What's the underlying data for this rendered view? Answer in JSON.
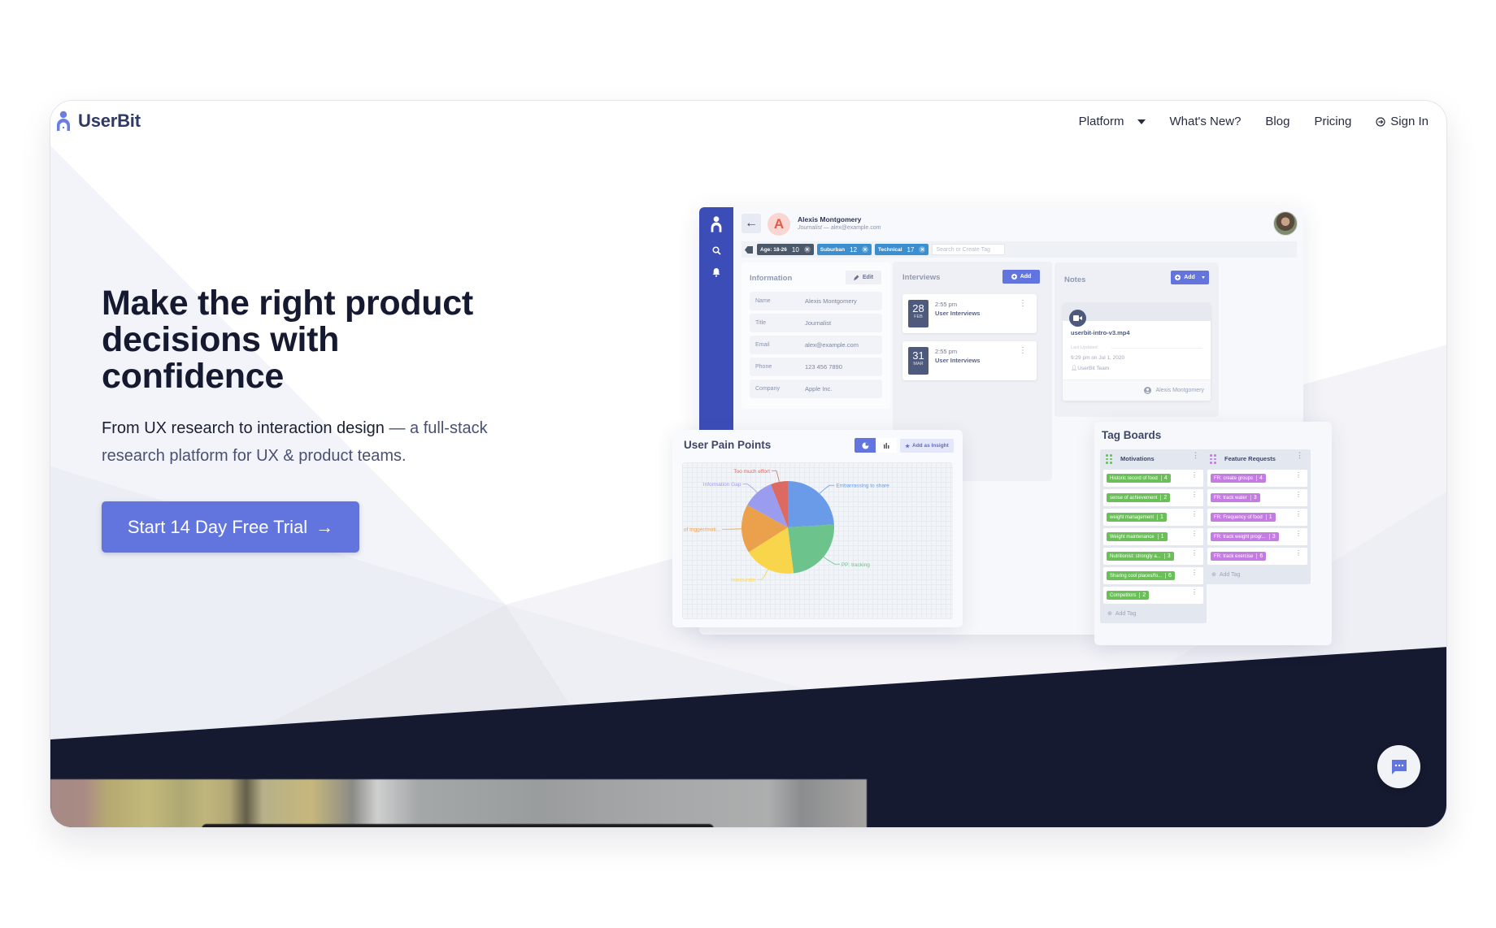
{
  "brand": {
    "name": "UserBit",
    "accent": "#6275de",
    "dark": "#151a30"
  },
  "nav": {
    "platform": "Platform",
    "whats_new": "What's New?",
    "blog": "Blog",
    "pricing": "Pricing",
    "sign_in": "Sign In"
  },
  "hero": {
    "headline": "Make the right product decisions with confidence",
    "sub_dark": "From UX research to interaction design",
    "sub_light": " — a full-stack research platform for UX & product teams.",
    "cta": "Start 14 Day Free Trial",
    "cta_arrow": "→"
  },
  "mockup": {
    "person": {
      "initial": "A",
      "name": "Alexis Montgomery",
      "role": "Journalist",
      "email": "— alex@example.com"
    },
    "tags": [
      {
        "label": "Age: 18-26",
        "count": "10",
        "style": "dk"
      },
      {
        "label": "Suburban",
        "count": "12",
        "style": "bl"
      },
      {
        "label": "Technical",
        "count": "17",
        "style": "bl"
      }
    ],
    "tag_search_placeholder": "Search or Create Tag",
    "information": {
      "title": "Information",
      "edit": "Edit",
      "rows": [
        {
          "k": "Name",
          "v": "Alexis Montgomery"
        },
        {
          "k": "Title",
          "v": "Journalist"
        },
        {
          "k": "Email",
          "v": "alex@example.com"
        },
        {
          "k": "Phone",
          "v": "123 456 7890"
        },
        {
          "k": "Company",
          "v": "Apple Inc."
        }
      ]
    },
    "interviews": {
      "title": "Interviews",
      "add": "Add",
      "items": [
        {
          "day": "28",
          "month": "FEB",
          "time": "2:55 pm",
          "title": "User Interviews"
        },
        {
          "day": "31",
          "month": "MAR",
          "time": "2:55 pm",
          "title": "User Interviews"
        }
      ]
    },
    "notes": {
      "title": "Notes",
      "add": "Add",
      "file": "userbit-intro-v3.mp4",
      "updated_label": "Last Updated",
      "updated": "9:29 pm on Jul 1, 2020",
      "team": "UserBit Team",
      "owner": "Alexis Montgomery"
    }
  },
  "pain_points": {
    "title": "User Pain Points",
    "add_insight": "Add as Insight",
    "chart_data": {
      "type": "pie",
      "title": "User Pain Points",
      "slices": [
        {
          "label": "Embarrassing to share",
          "value": 24,
          "color": "#6a9be8"
        },
        {
          "label": "PP: tracking",
          "value": 24,
          "color": "#6cc38b"
        },
        {
          "label": "Inaccurate",
          "value": 18,
          "color": "#f8d54a"
        },
        {
          "label": "lack of trigger/moti...",
          "value": 17,
          "color": "#eba04c"
        },
        {
          "label": "Information Gap",
          "value": 11,
          "color": "#9a9cf0"
        },
        {
          "label": "Too much effort",
          "value": 6,
          "color": "#dc6a63"
        }
      ]
    }
  },
  "tag_boards": {
    "title": "Tag Boards",
    "add_tag": "Add Tag",
    "columns": [
      {
        "name": "Motivations",
        "color": "#6bbf59",
        "tags": [
          {
            "label": "Historic record of food",
            "count": "4"
          },
          {
            "label": "sense of achievement",
            "count": "2"
          },
          {
            "label": "weight management",
            "count": "1"
          },
          {
            "label": "Weight maintenance",
            "count": "1"
          },
          {
            "label": "Nutritionist: strongly a...",
            "count": "3"
          },
          {
            "label": "Sharing cool places/fo...",
            "count": "6"
          },
          {
            "label": "Competitors",
            "count": "2"
          }
        ]
      },
      {
        "name": "Feature Requests",
        "color": "#c37de0",
        "tags": [
          {
            "label": "FR: create groups",
            "count": "4"
          },
          {
            "label": "FR: track water",
            "count": "3"
          },
          {
            "label": "FR: Frequency of food",
            "count": "1"
          },
          {
            "label": "FR: track weight progr...",
            "count": "3"
          },
          {
            "label": "FR: track exercise",
            "count": "6"
          }
        ]
      }
    ]
  }
}
